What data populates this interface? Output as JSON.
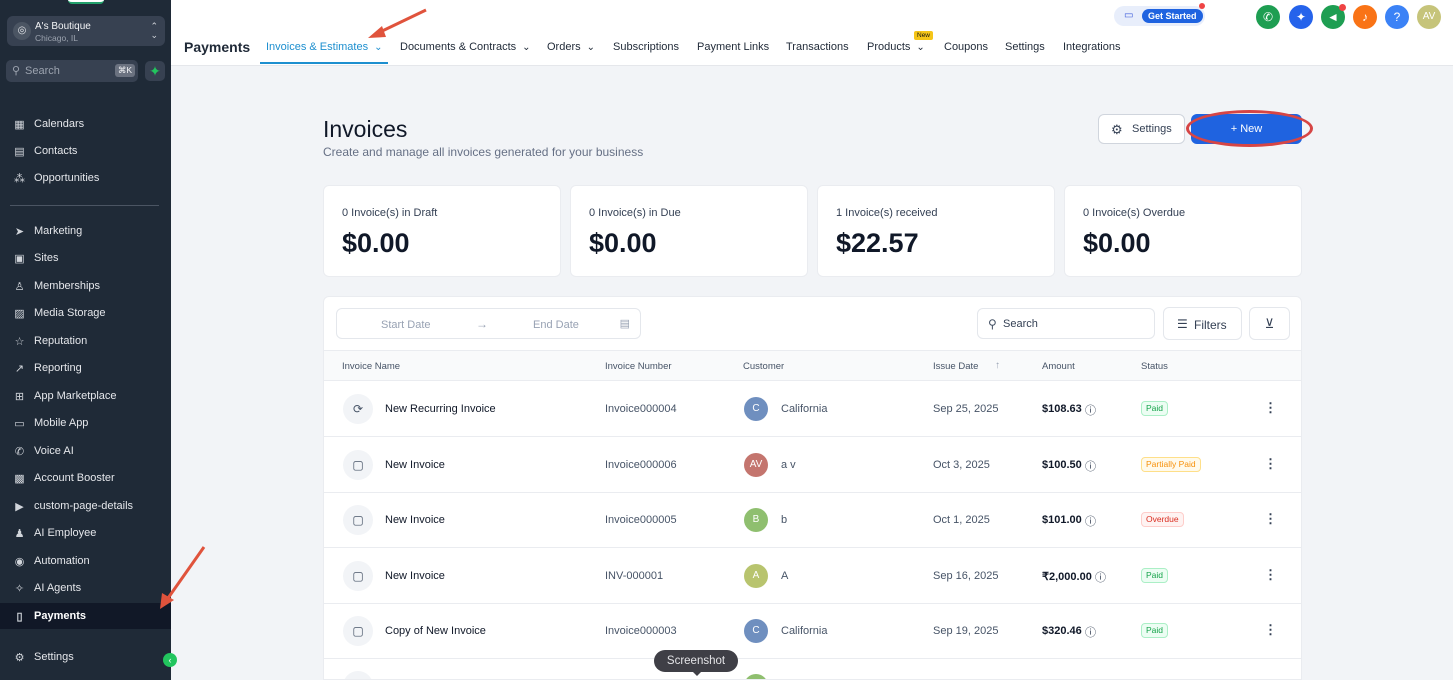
{
  "sidebar": {
    "account_name": "A's Boutique",
    "account_location": "Chicago, IL",
    "search_placeholder": "Search",
    "search_shortcut": "⌘K",
    "items": [
      {
        "label": "Calendars",
        "icon": "calendar-icon",
        "glyph": "▦"
      },
      {
        "label": "Contacts",
        "icon": "contacts-icon",
        "glyph": "▤"
      },
      {
        "label": "Opportunities",
        "icon": "opportunities-icon",
        "glyph": "⁂"
      },
      {
        "label": "Marketing",
        "icon": "send-icon",
        "glyph": "➤"
      },
      {
        "label": "Sites",
        "icon": "sites-icon",
        "glyph": "▣"
      },
      {
        "label": "Memberships",
        "icon": "membership-icon",
        "glyph": "♙"
      },
      {
        "label": "Media Storage",
        "icon": "image-icon",
        "glyph": "▨"
      },
      {
        "label": "Reputation",
        "icon": "star-icon",
        "glyph": "☆"
      },
      {
        "label": "Reporting",
        "icon": "trend-icon",
        "glyph": "↗"
      },
      {
        "label": "App Marketplace",
        "icon": "grid-icon",
        "glyph": "⊞"
      },
      {
        "label": "Mobile App",
        "icon": "mobile-icon",
        "glyph": "▭"
      },
      {
        "label": "Voice AI",
        "icon": "phone-icon",
        "glyph": "✆"
      },
      {
        "label": "Account Booster",
        "icon": "booster-icon",
        "glyph": "▩"
      },
      {
        "label": "custom-page-details",
        "icon": "page-icon",
        "glyph": "▶"
      },
      {
        "label": "AI Employee",
        "icon": "user-icon",
        "glyph": "♟"
      },
      {
        "label": "Automation",
        "icon": "automation-icon",
        "glyph": "◉"
      },
      {
        "label": "AI Agents",
        "icon": "sparkle-icon",
        "glyph": "✧"
      },
      {
        "label": "Payments",
        "icon": "receipt-icon",
        "glyph": "▯"
      },
      {
        "label": "Settings",
        "icon": "gear-icon",
        "glyph": "⚙"
      }
    ]
  },
  "topbar": {
    "app_title": "Payments",
    "tabs": [
      {
        "label": "Invoices & Estimates",
        "has_dropdown": true
      },
      {
        "label": "Documents & Contracts",
        "has_dropdown": true
      },
      {
        "label": "Orders",
        "has_dropdown": true
      },
      {
        "label": "Subscriptions",
        "has_dropdown": false
      },
      {
        "label": "Payment Links",
        "has_dropdown": false
      },
      {
        "label": "Transactions",
        "has_dropdown": false
      },
      {
        "label": "Products",
        "has_dropdown": true
      },
      {
        "label": "Coupons",
        "has_dropdown": false
      },
      {
        "label": "Settings",
        "has_dropdown": false
      },
      {
        "label": "Integrations",
        "has_dropdown": false
      }
    ],
    "new_badge": "New",
    "get_started": "Get Started",
    "avatar_initials": "AV",
    "colors": {
      "accent": "#1d8fcf",
      "primary": "#1f63e0"
    }
  },
  "main": {
    "title": "Invoices",
    "subtitle": "Create and manage all invoices generated for your business",
    "settings_label": "Settings",
    "new_label": "+ New",
    "cards": [
      {
        "label": "0 Invoice(s) in Draft",
        "value": "$0.00"
      },
      {
        "label": "0 Invoice(s) in Due",
        "value": "$0.00"
      },
      {
        "label": "1 Invoice(s) received",
        "value": "$22.57"
      },
      {
        "label": "0 Invoice(s) Overdue",
        "value": "$0.00"
      }
    ],
    "filters": {
      "start_date": "Start Date",
      "end_date": "End Date",
      "search_placeholder": "Search",
      "filters_label": "Filters"
    },
    "columns": [
      "Invoice Name",
      "Invoice Number",
      "Customer",
      "Issue Date",
      "Amount",
      "Status"
    ],
    "rows": [
      {
        "icon": "recurring-icon",
        "glyph": "⟳",
        "name": "New Recurring Invoice",
        "number": "Invoice000004",
        "avatar": "C",
        "avatar_color": "#6f8fbf",
        "customer": "California",
        "date": "Sep 25, 2025",
        "amount": "$108.63",
        "status": "Paid",
        "status_type": "paid"
      },
      {
        "icon": "invoice-icon",
        "glyph": "▢",
        "name": "New Invoice",
        "number": "Invoice000006",
        "avatar": "AV",
        "avatar_color": "#c4756e",
        "customer": "a v",
        "date": "Oct 3, 2025",
        "amount": "$100.50",
        "status": "Partially Paid",
        "status_type": "partial"
      },
      {
        "icon": "invoice-icon",
        "glyph": "▢",
        "name": "New Invoice",
        "number": "Invoice000005",
        "avatar": "B",
        "avatar_color": "#8fbf6f",
        "customer": "b",
        "date": "Oct 1, 2025",
        "amount": "$101.00",
        "status": "Overdue",
        "status_type": "overdue"
      },
      {
        "icon": "invoice-icon",
        "glyph": "▢",
        "name": "New Invoice",
        "number": "INV-000001",
        "avatar": "A",
        "avatar_color": "#b8c46e",
        "customer": "A",
        "date": "Sep 16, 2025",
        "amount": "₹2,000.00",
        "status": "Paid",
        "status_type": "paid"
      },
      {
        "icon": "invoice-icon",
        "glyph": "▢",
        "name": "Copy of New Invoice",
        "number": "Invoice000003",
        "avatar": "C",
        "avatar_color": "#6f8fbf",
        "customer": "California",
        "date": "Sep 19, 2025",
        "amount": "$320.46",
        "status": "Paid",
        "status_type": "paid"
      }
    ],
    "status_colors": {
      "paid": {
        "fg": "#16a34a",
        "bg": "#ecfdf3",
        "border": "#abefc6"
      },
      "partial": {
        "fg": "#f79009",
        "bg": "#fffaeb",
        "border": "#fedf89"
      },
      "overdue": {
        "fg": "#d92d20",
        "bg": "#fef3f2",
        "border": "#fecdca"
      }
    }
  },
  "tooltip": "Screenshot"
}
